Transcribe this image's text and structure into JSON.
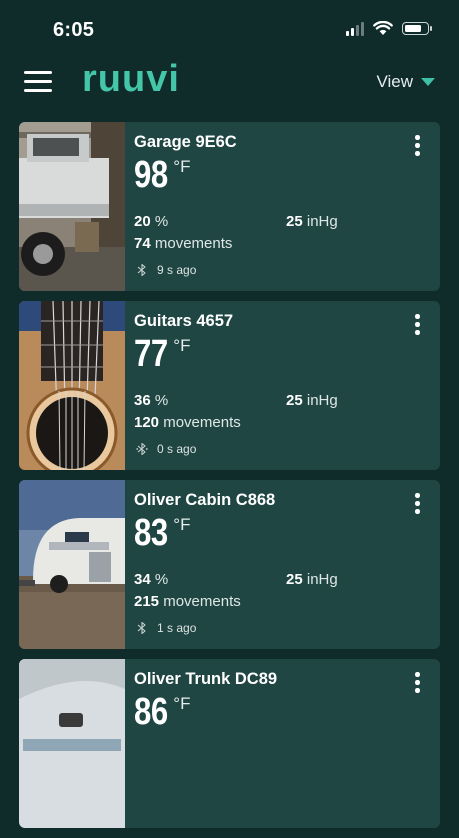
{
  "status_bar": {
    "time": "6:05"
  },
  "app_bar": {
    "logo": "ruuvi",
    "view_label": "View"
  },
  "colors": {
    "background": "#0f2b2a",
    "card": "#1f4643",
    "accent": "#44c6a8"
  },
  "cards": [
    {
      "name": "Garage 9E6C",
      "temperature": "98",
      "temp_unit": "°F",
      "humidity": "20",
      "humidity_unit": "%",
      "pressure": "25",
      "pressure_unit": "inHg",
      "movements": "74",
      "movements_label": "movements",
      "last_seen": "9 s ago",
      "signal_icon": "bluetooth-icon"
    },
    {
      "name": "Guitars 4657",
      "temperature": "77",
      "temp_unit": "°F",
      "humidity": "36",
      "humidity_unit": "%",
      "pressure": "25",
      "pressure_unit": "inHg",
      "movements": "120",
      "movements_label": "movements",
      "last_seen": "0 s ago",
      "signal_icon": "gateway-icon"
    },
    {
      "name": "Oliver Cabin C868",
      "temperature": "83",
      "temp_unit": "°F",
      "humidity": "34",
      "humidity_unit": "%",
      "pressure": "25",
      "pressure_unit": "inHg",
      "movements": "215",
      "movements_label": "movements",
      "last_seen": "1 s ago",
      "signal_icon": "bluetooth-icon"
    },
    {
      "name": "Oliver Trunk DC89",
      "temperature": "86",
      "temp_unit": "°F"
    }
  ]
}
